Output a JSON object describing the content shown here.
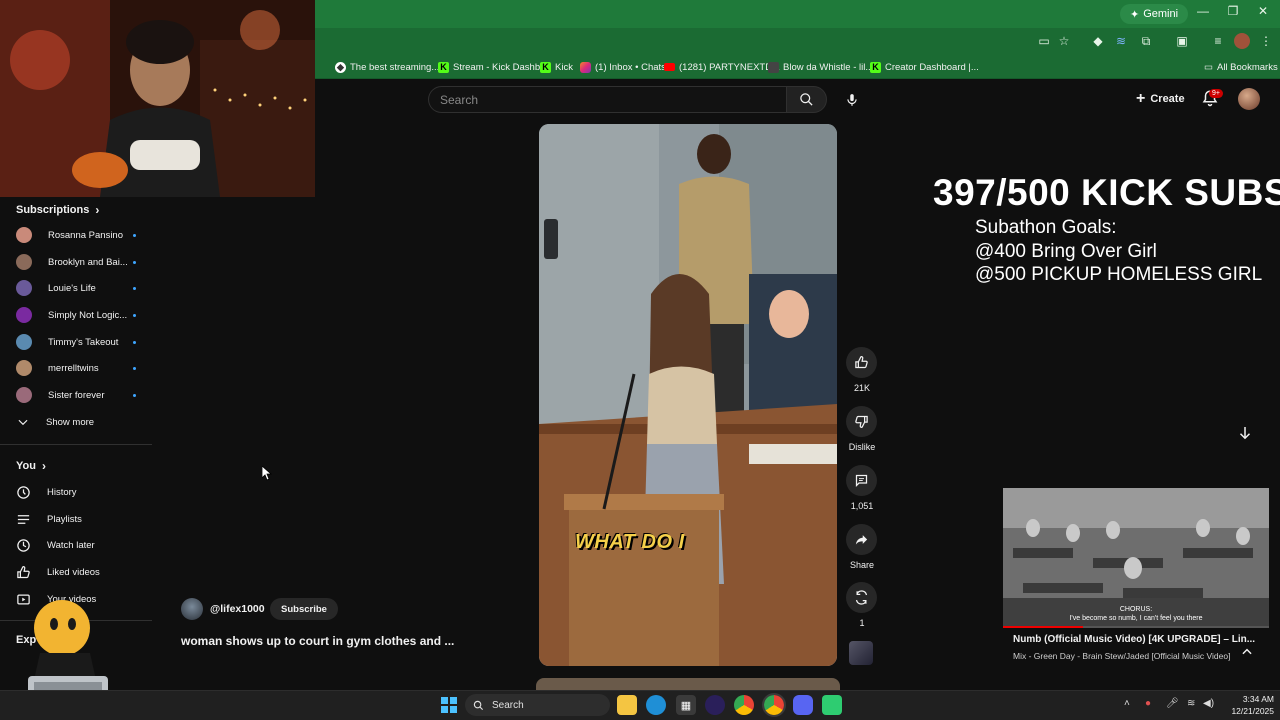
{
  "browser": {
    "gemini_label": "Gemini",
    "bookmarks": [
      {
        "label": "The best streaming..."
      },
      {
        "label": "Stream - Kick Dashb..."
      },
      {
        "label": "Kick"
      },
      {
        "label": "(1) Inbox • Chats"
      },
      {
        "label": "(1281) PARTYNEXTD..."
      },
      {
        "label": "Blow da Whistle - lil..."
      },
      {
        "label": "Creator Dashboard |..."
      }
    ],
    "all_bookmarks": "All Bookmarks"
  },
  "header": {
    "search_placeholder": "Search",
    "create_label": "Create",
    "notification_count": "9+"
  },
  "sidebar": {
    "subscriptions_title": "Subscriptions",
    "subscriptions": [
      {
        "name": "Rosanna Pansino"
      },
      {
        "name": "Brooklyn and Bai..."
      },
      {
        "name": "Louie's Life"
      },
      {
        "name": "Simply Not Logic..."
      },
      {
        "name": "Timmy's Takeout"
      },
      {
        "name": "merrelltwins"
      },
      {
        "name": "Sister forever"
      }
    ],
    "show_more": "Show more",
    "you_title": "You",
    "you_items": [
      {
        "label": "History",
        "icon": "history-icon"
      },
      {
        "label": "Playlists",
        "icon": "playlists-icon"
      },
      {
        "label": "Watch later",
        "icon": "watch-later-icon"
      },
      {
        "label": "Liked videos",
        "icon": "liked-videos-icon"
      },
      {
        "label": "Your videos",
        "icon": "your-videos-icon"
      }
    ],
    "explore_partial": "Exp"
  },
  "short": {
    "caption": "WHAT DO I",
    "channel": "@lifex1000",
    "subscribe_label": "Subscribe",
    "title": "woman shows up to court in gym clothes and ...",
    "likes": "21K",
    "dislike_label": "Dislike",
    "comments": "1,051",
    "share_label": "Share",
    "remix_count": "1"
  },
  "overlay": {
    "kick_subs": "397/500 KICK SUBS",
    "goals_title": "Subathon Goals:",
    "goal_1": "@400 Bring Over Girl",
    "goal_2": "@500 PICKUP HOMELESS GIRL"
  },
  "music": {
    "chorus": "CHORUS:",
    "lyric": "I've become so numb, I can't feel you there",
    "title": "Numb (Official Music Video) [4K UPGRADE] – Lin...",
    "subtitle": "Mix - Green Day - Brain Stew/Jaded [Official Music Video]",
    "progress": 0.3
  },
  "taskbar": {
    "search_label": "Search",
    "time": "3:34 AM",
    "date": "12/21/2025"
  },
  "colors": {
    "chrome_green": "#1f7a3a",
    "yt_bg": "#0f0f0f",
    "caption_yellow": "#f5d04a",
    "kick_green": "#53fc18"
  }
}
